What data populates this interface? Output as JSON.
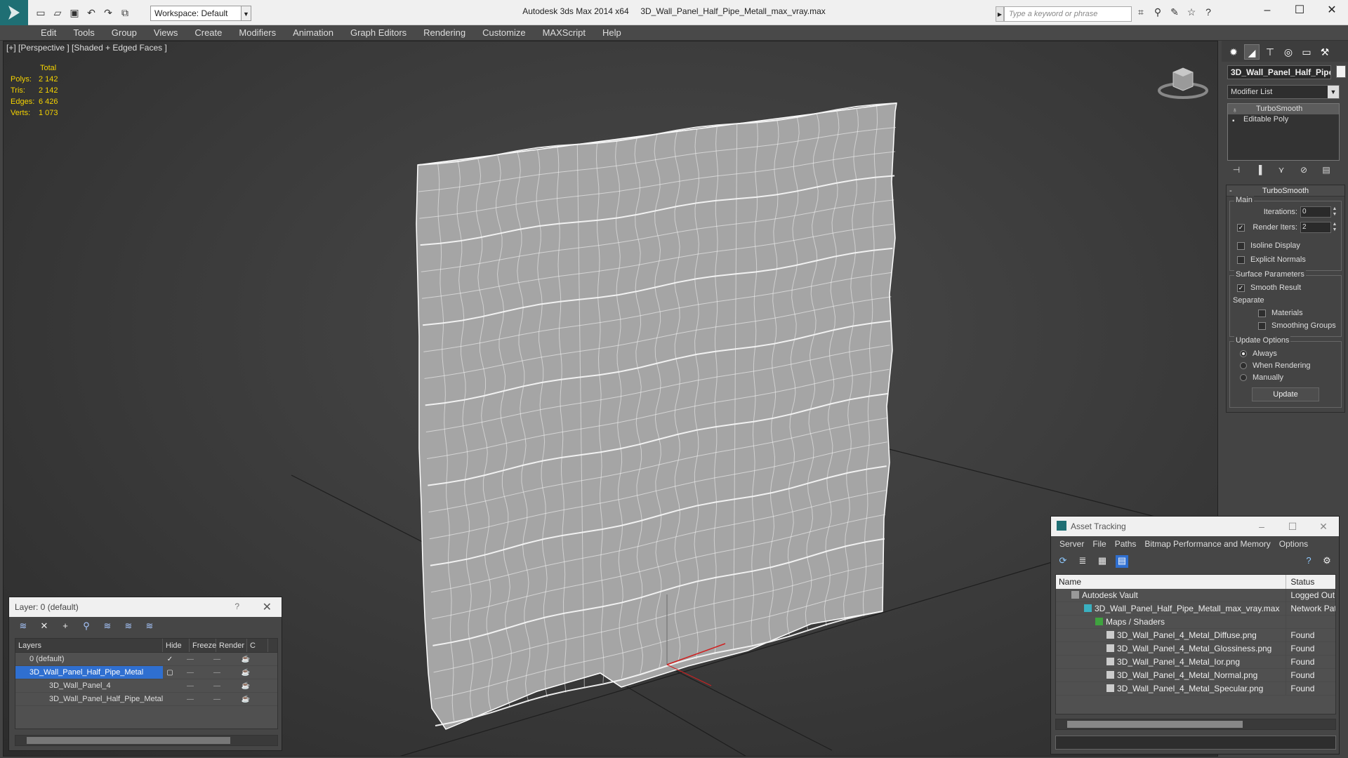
{
  "window": {
    "app_title": "Autodesk 3ds Max  2014 x64",
    "file_title": "3D_Wall_Panel_Half_Pipe_Metall_max_vray.max",
    "workspace": "Workspace: Default",
    "search_placeholder": "Type a keyword or phrase"
  },
  "menu": [
    "Edit",
    "Tools",
    "Group",
    "Views",
    "Create",
    "Modifiers",
    "Animation",
    "Graph Editors",
    "Rendering",
    "Customize",
    "MAXScript",
    "Help"
  ],
  "viewport": {
    "label": "[+] [Perspective ] [Shaded + Edged Faces ]",
    "stats": {
      "header": "Total",
      "rows": [
        {
          "k": "Polys:",
          "v": "2 142"
        },
        {
          "k": "Tris:",
          "v": "2 142"
        },
        {
          "k": "Edges:",
          "v": "6 426"
        },
        {
          "k": "Verts:",
          "v": "1 073"
        }
      ]
    },
    "colors": {
      "stats": "#f5d300",
      "wire": "#ffffff",
      "mesh": "#a9a9a9",
      "grid": "#1a1a1a"
    }
  },
  "command_panel": {
    "object_name": "3D_Wall_Panel_Half_Pipe",
    "modifier_list": "Modifier List",
    "stack": [
      "TurboSmooth",
      "Editable Poly"
    ],
    "rollout": {
      "title": "TurboSmooth",
      "main_group": "Main",
      "iterations_label": "Iterations:",
      "iterations": "0",
      "render_iters_label": "Render Iters:",
      "render_iters": "2",
      "isoline": "Isoline Display",
      "explicit": "Explicit Normals",
      "surface_group": "Surface Parameters",
      "smooth_result": "Smooth Result",
      "separate": "Separate",
      "materials": "Materials",
      "smoothing_groups": "Smoothing Groups",
      "update_group": "Update Options",
      "always": "Always",
      "when_rendering": "When Rendering",
      "manually": "Manually",
      "update_button": "Update"
    }
  },
  "layer_window": {
    "title": "Layer: 0 (default)",
    "help": "?",
    "columns": [
      "Layers",
      "Hide",
      "Freeze",
      "Render",
      "C"
    ],
    "rows": [
      {
        "name": "0 (default)"
      },
      {
        "name": "3D_Wall_Panel_Half_Pipe_Metal"
      },
      {
        "name": "3D_Wall_Panel_4"
      },
      {
        "name": "3D_Wall_Panel_Half_Pipe_Metal"
      }
    ]
  },
  "asset_window": {
    "title": "Asset Tracking",
    "menu": [
      "Server",
      "File",
      "Paths",
      "Bitmap Performance and Memory",
      "Options"
    ],
    "columns": {
      "name": "Name",
      "status": "Status"
    },
    "rows": [
      {
        "name": "Autodesk Vault",
        "status": "Logged Out"
      },
      {
        "name": "3D_Wall_Panel_Half_Pipe_Metall_max_vray.max",
        "status": "Network Pat"
      },
      {
        "name": "Maps / Shaders",
        "status": ""
      },
      {
        "name": "3D_Wall_Panel_4_Metal_Diffuse.png",
        "status": "Found"
      },
      {
        "name": "3D_Wall_Panel_4_Metal_Glossiness.png",
        "status": "Found"
      },
      {
        "name": "3D_Wall_Panel_4_Metal_Ior.png",
        "status": "Found"
      },
      {
        "name": "3D_Wall_Panel_4_Metal_Normal.png",
        "status": "Found"
      },
      {
        "name": "3D_Wall_Panel_4_Metal_Specular.png",
        "status": "Found"
      }
    ]
  }
}
